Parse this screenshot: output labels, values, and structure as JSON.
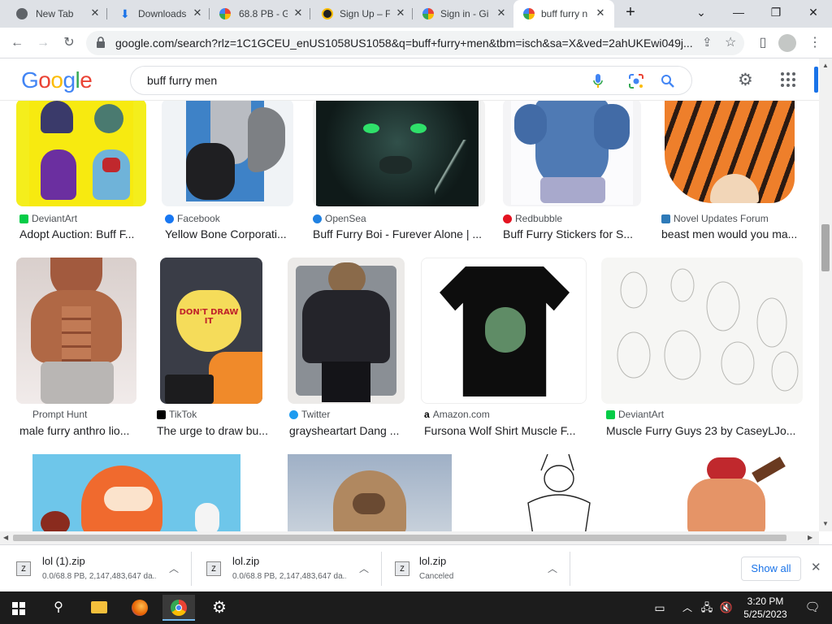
{
  "tabs": [
    {
      "title": "New Tab",
      "active": false
    },
    {
      "title": "Downloads",
      "active": false
    },
    {
      "title": "68.8 PB - G",
      "active": false
    },
    {
      "title": "Sign Up – F",
      "active": false
    },
    {
      "title": "Sign in - Gi",
      "active": false
    },
    {
      "title": "buff furry n",
      "active": true
    }
  ],
  "address": {
    "url": "google.com/search?rlz=1C1GCEU_enUS1058US1058&q=buff+furry+men&tbm=isch&sa=X&ved=2ahUKEwi049j..."
  },
  "search": {
    "query": "buff furry men"
  },
  "logo": {
    "letters": [
      "G",
      "o",
      "o",
      "g",
      "l",
      "e"
    ]
  },
  "results": {
    "row1": [
      {
        "source": "DeviantArt",
        "caption": "Adopt Auction: Buff F..."
      },
      {
        "source": "Facebook",
        "caption": "Yellow Bone Corporati..."
      },
      {
        "source": "OpenSea",
        "caption": "Buff Furry Boi - Furever Alone | ..."
      },
      {
        "source": "Redbubble",
        "caption": "Buff Furry Stickers for S..."
      },
      {
        "source": "Novel Updates Forum",
        "caption": "beast men would you ma..."
      }
    ],
    "row2": [
      {
        "source": "Prompt Hunt",
        "caption": "male furry anthro lio..."
      },
      {
        "source": "TikTok",
        "caption": "The urge to draw bu..."
      },
      {
        "source": "Twitter",
        "caption": "graysheartart Dang ..."
      },
      {
        "source": "Amazon.com",
        "caption": "Fursona Wolf Shirt Muscle F..."
      },
      {
        "source": "DeviantArt",
        "caption": "Muscle Furry Guys 23 by CaseyLJo..."
      }
    ]
  },
  "image_text": {
    "sign": "DON'T DRAW IT"
  },
  "downloads": [
    {
      "name": "lol (1).zip",
      "status": "0.0/68.8 PB, 2,147,483,647 da..."
    },
    {
      "name": "lol.zip",
      "status": "0.0/68.8 PB, 2,147,483,647 da..."
    },
    {
      "name": "lol.zip",
      "status": "Canceled"
    }
  ],
  "download_bar": {
    "show_all": "Show all"
  },
  "taskbar": {
    "time": "3:20 PM",
    "date": "5/25/2023"
  },
  "colors": {
    "google_blue": "#4285f4",
    "google_red": "#ea4335",
    "google_yellow": "#fbbc05",
    "google_green": "#34a853"
  }
}
